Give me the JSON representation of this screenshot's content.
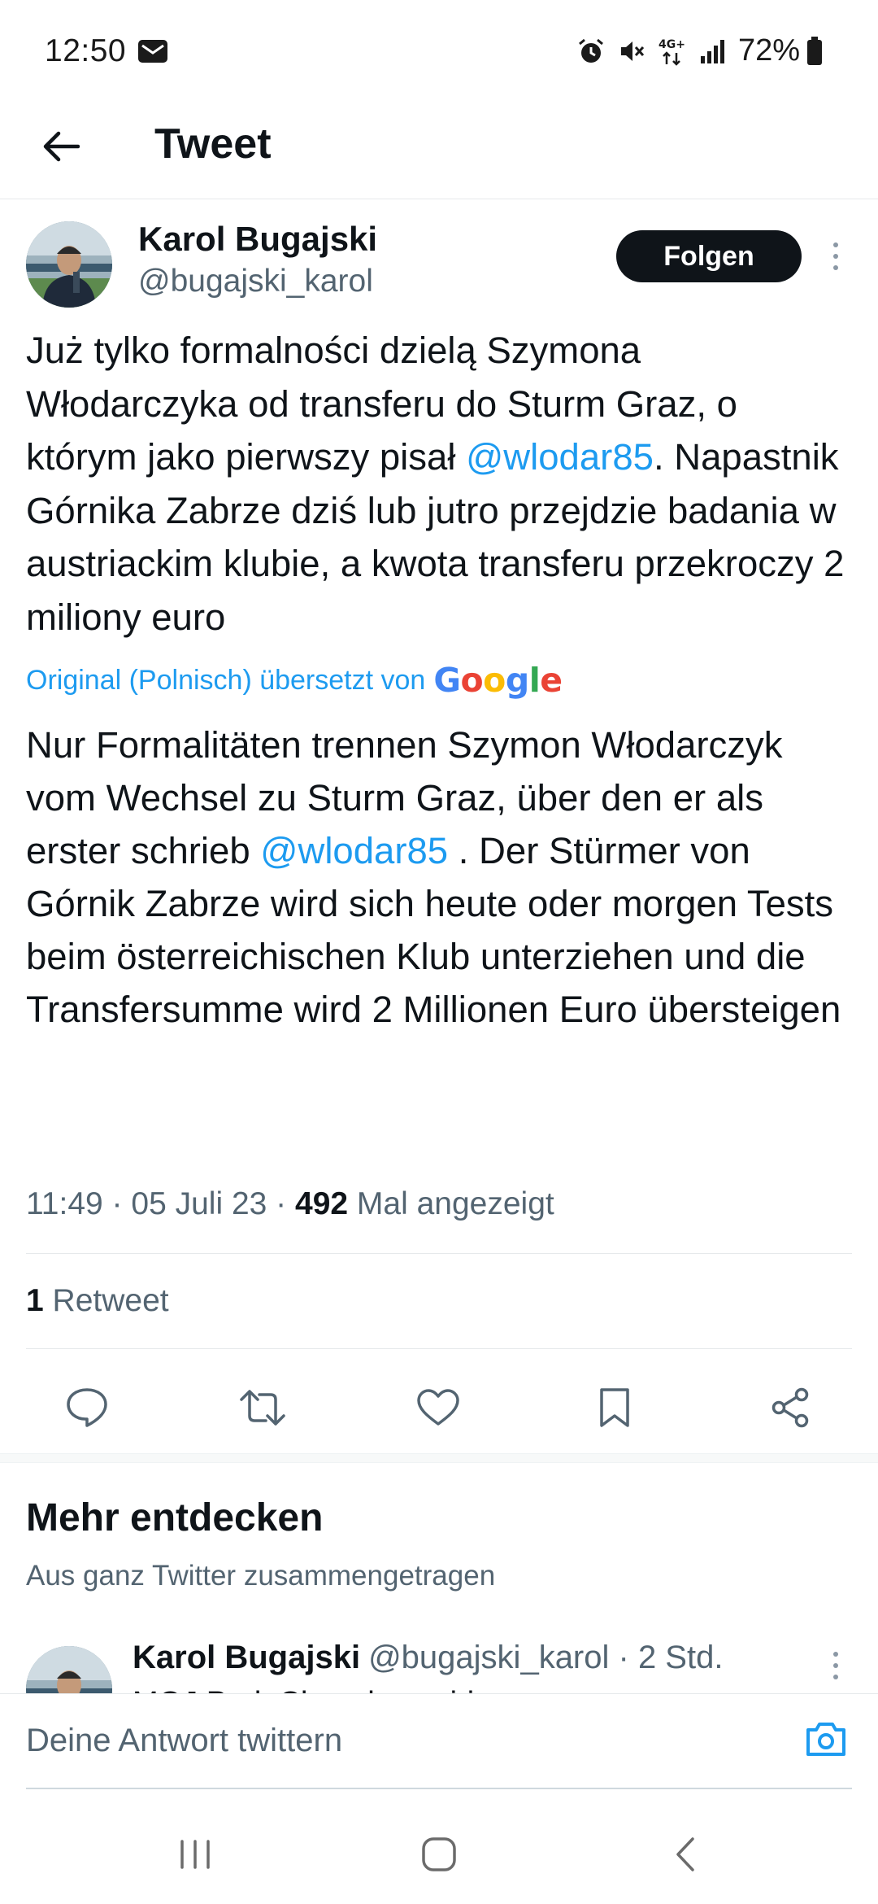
{
  "status_bar": {
    "time": "12:50",
    "battery": "72%",
    "network": "4G+",
    "icons": [
      "mail-icon",
      "alarm-icon",
      "mute-icon",
      "network-4g-icon",
      "signal-icon",
      "battery-icon"
    ]
  },
  "header": {
    "title": "Tweet",
    "back_icon": "arrow-left-icon"
  },
  "tweet": {
    "author_name": "Karol Bugajski",
    "author_handle": "@bugajski_karol",
    "follow_label": "Folgen",
    "text": {
      "before_mention": "Już tylko formalności dzielą Szymona Włodarczyka od transferu do Sturm Graz, o którym jako pierwszy pisał ",
      "mention": "@wlodar85",
      "after_mention": ". Napastnik Górnika Zabrze dziś lub jutro przejdzie badania w austriackim klubie, a kwota transferu przekroczy 2 miliony euro"
    },
    "translation_note": "Original (Polnisch) übersetzt von",
    "translation_provider": "Google",
    "translated_text": {
      "before_mention": "Nur Formalitäten trennen Szymon Włodarczyk vom Wechsel zu Sturm Graz, über den er als erster schrieb ",
      "mention": "@wlodar85",
      "after_mention": " . Der Stürmer von Górnik Zabrze wird sich heute oder morgen Tests beim österreichischen Klub unterziehen und die Transfersumme wird 2 Millionen Euro übersteigen"
    },
    "time": "11:49",
    "date": "05 Juli 23",
    "views_count": "492",
    "views_label": "Mal angezeigt",
    "separator": " · ",
    "retweets_count": "1",
    "retweets_label": "Retweet"
  },
  "actions": [
    "reply-icon",
    "retweet-icon",
    "like-icon",
    "bookmark-icon",
    "share-icon"
  ],
  "discover": {
    "title": "Mehr entdecken",
    "subtitle": "Aus ganz Twitter zusammengetragen",
    "related_name": "Karol Bugajski",
    "related_handle": "@bugajski_karol",
    "related_time": "· 2 Std.",
    "related_peek": "MOJ Pork Chowdomocirio"
  },
  "reply": {
    "placeholder": "Deine Antwort twittern",
    "camera_icon": "camera-icon"
  },
  "nav": [
    "recent-apps-icon",
    "home-icon",
    "back-icon"
  ],
  "colors": {
    "accent": "#1d9bf0",
    "text": "#0f1419",
    "secondary": "#536471",
    "follow_button": "#0f1419"
  }
}
